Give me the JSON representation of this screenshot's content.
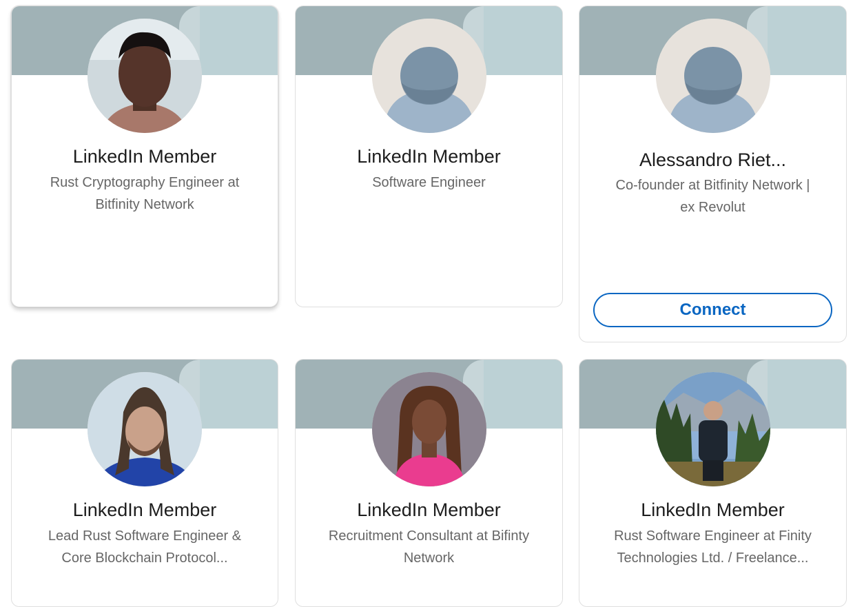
{
  "cards": [
    {
      "name": "LinkedIn Member",
      "headline": [
        "Rust Cryptography Engineer at",
        "Bitfinity Network"
      ],
      "avatar": "photo-man-dark-hair"
    },
    {
      "name": "LinkedIn Member",
      "headline": [
        "Software Engineer"
      ],
      "avatar": "default-avatar"
    },
    {
      "name": "Alessandro Riet...",
      "headline": [
        "Co-founder at Bitfinity Network |",
        "ex Revolut"
      ],
      "avatar": "default-avatar",
      "action": "Connect"
    },
    {
      "name": "LinkedIn Member",
      "headline": [
        "Lead Rust Software Engineer &",
        "Core Blockchain Protocol..."
      ],
      "avatar": "photo-man-long-hair"
    },
    {
      "name": "LinkedIn Member",
      "headline": [
        "Recruitment Consultant at Bifinty",
        "Network"
      ],
      "avatar": "photo-woman-pink"
    },
    {
      "name": "LinkedIn Member",
      "headline": [
        "Rust Software Engineer at Finity",
        "Technologies Ltd. / Freelance..."
      ],
      "avatar": "photo-man-lake"
    }
  ],
  "colors": {
    "banner": "#a0b2b6",
    "accent": "#0a66c2",
    "name_text": "#1d1d1d",
    "headline_text": "#666666",
    "default_avatar_bg": "#e7e2dc",
    "default_avatar_head": "#7b93a7",
    "default_avatar_body": "#9eb4c9"
  }
}
